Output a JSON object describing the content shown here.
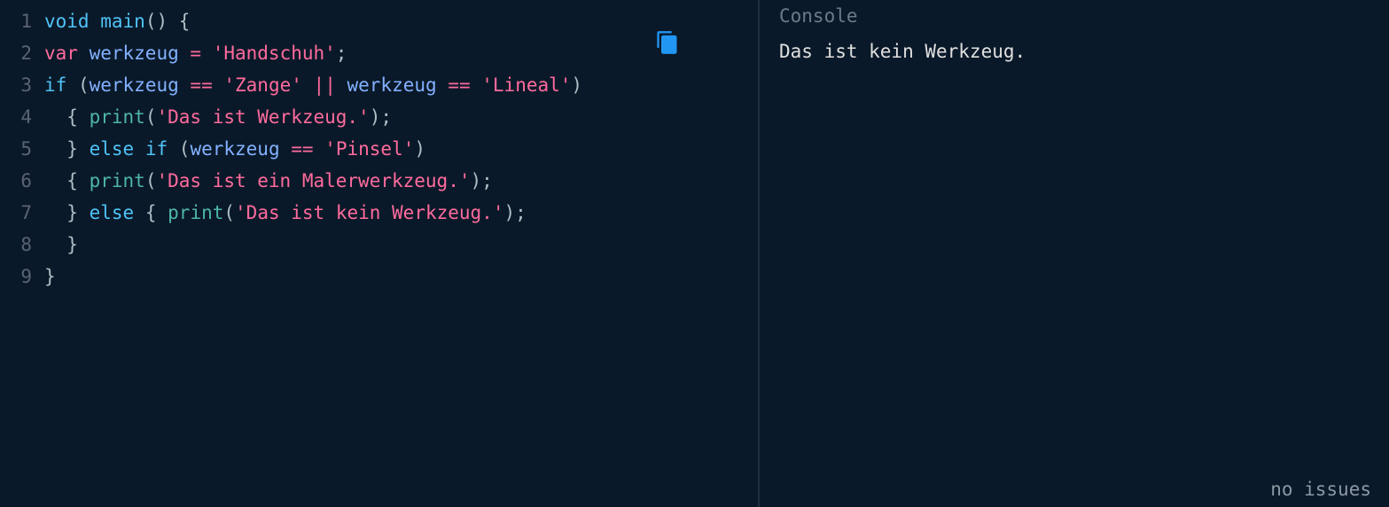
{
  "editor": {
    "lines": [
      {
        "num": "1",
        "tokens": [
          {
            "t": "void",
            "c": "tok-keyword"
          },
          {
            "t": " ",
            "c": "tok-plain"
          },
          {
            "t": "main",
            "c": "tok-func"
          },
          {
            "t": "()",
            "c": "tok-paren"
          },
          {
            "t": " ",
            "c": "tok-plain"
          },
          {
            "t": "{",
            "c": "tok-brace"
          }
        ]
      },
      {
        "num": "2",
        "tokens": [
          {
            "t": "var",
            "c": "tok-var"
          },
          {
            "t": " ",
            "c": "tok-plain"
          },
          {
            "t": "werkzeug",
            "c": "tok-ident"
          },
          {
            "t": " ",
            "c": "tok-plain"
          },
          {
            "t": "=",
            "c": "tok-assign"
          },
          {
            "t": " ",
            "c": "tok-plain"
          },
          {
            "t": "'Handschuh'",
            "c": "tok-string"
          },
          {
            "t": ";",
            "c": "tok-semi"
          }
        ]
      },
      {
        "num": "3",
        "tokens": [
          {
            "t": "if",
            "c": "tok-keyword"
          },
          {
            "t": " ",
            "c": "tok-plain"
          },
          {
            "t": "(",
            "c": "tok-paren"
          },
          {
            "t": "werkzeug",
            "c": "tok-ident"
          },
          {
            "t": " ",
            "c": "tok-plain"
          },
          {
            "t": "==",
            "c": "tok-op"
          },
          {
            "t": " ",
            "c": "tok-plain"
          },
          {
            "t": "'Zange'",
            "c": "tok-string"
          },
          {
            "t": " ",
            "c": "tok-plain"
          },
          {
            "t": "||",
            "c": "tok-op"
          },
          {
            "t": " ",
            "c": "tok-plain"
          },
          {
            "t": "werkzeug",
            "c": "tok-ident"
          },
          {
            "t": " ",
            "c": "tok-plain"
          },
          {
            "t": "==",
            "c": "tok-op"
          },
          {
            "t": " ",
            "c": "tok-plain"
          },
          {
            "t": "'Lineal'",
            "c": "tok-string"
          },
          {
            "t": ")",
            "c": "tok-paren"
          }
        ]
      },
      {
        "num": "4",
        "tokens": [
          {
            "t": "  ",
            "c": "tok-plain"
          },
          {
            "t": "{",
            "c": "tok-brace"
          },
          {
            "t": " ",
            "c": "tok-plain"
          },
          {
            "t": "print",
            "c": "tok-call"
          },
          {
            "t": "(",
            "c": "tok-paren"
          },
          {
            "t": "'Das ist Werkzeug.'",
            "c": "tok-string"
          },
          {
            "t": ")",
            "c": "tok-paren"
          },
          {
            "t": ";",
            "c": "tok-semi"
          }
        ]
      },
      {
        "num": "5",
        "tokens": [
          {
            "t": "  ",
            "c": "tok-plain"
          },
          {
            "t": "}",
            "c": "tok-brace"
          },
          {
            "t": " ",
            "c": "tok-plain"
          },
          {
            "t": "else",
            "c": "tok-keyword"
          },
          {
            "t": " ",
            "c": "tok-plain"
          },
          {
            "t": "if",
            "c": "tok-keyword"
          },
          {
            "t": " ",
            "c": "tok-plain"
          },
          {
            "t": "(",
            "c": "tok-paren"
          },
          {
            "t": "werkzeug",
            "c": "tok-ident"
          },
          {
            "t": " ",
            "c": "tok-plain"
          },
          {
            "t": "==",
            "c": "tok-op"
          },
          {
            "t": " ",
            "c": "tok-plain"
          },
          {
            "t": "'Pinsel'",
            "c": "tok-string"
          },
          {
            "t": ")",
            "c": "tok-paren"
          }
        ]
      },
      {
        "num": "6",
        "tokens": [
          {
            "t": "  ",
            "c": "tok-plain"
          },
          {
            "t": "{",
            "c": "tok-brace"
          },
          {
            "t": " ",
            "c": "tok-plain"
          },
          {
            "t": "print",
            "c": "tok-call"
          },
          {
            "t": "(",
            "c": "tok-paren"
          },
          {
            "t": "'Das ist ein Malerwerkzeug.'",
            "c": "tok-string"
          },
          {
            "t": ")",
            "c": "tok-paren"
          },
          {
            "t": ";",
            "c": "tok-semi"
          }
        ]
      },
      {
        "num": "7",
        "tokens": [
          {
            "t": "  ",
            "c": "tok-plain"
          },
          {
            "t": "}",
            "c": "tok-brace"
          },
          {
            "t": " ",
            "c": "tok-plain"
          },
          {
            "t": "else",
            "c": "tok-keyword"
          },
          {
            "t": " ",
            "c": "tok-plain"
          },
          {
            "t": "{",
            "c": "tok-brace"
          },
          {
            "t": " ",
            "c": "tok-plain"
          },
          {
            "t": "print",
            "c": "tok-call"
          },
          {
            "t": "(",
            "c": "tok-paren"
          },
          {
            "t": "'Das ist kein Werkzeug.'",
            "c": "tok-string"
          },
          {
            "t": ")",
            "c": "tok-paren"
          },
          {
            "t": ";",
            "c": "tok-semi"
          }
        ]
      },
      {
        "num": "8",
        "tokens": [
          {
            "t": "  ",
            "c": "tok-plain"
          },
          {
            "t": "}",
            "c": "tok-brace"
          }
        ]
      },
      {
        "num": "9",
        "tokens": [
          {
            "t": "}",
            "c": "tok-brace"
          }
        ]
      }
    ]
  },
  "console": {
    "title": "Console",
    "output": "Das ist kein Werkzeug.",
    "status": "no issues"
  }
}
